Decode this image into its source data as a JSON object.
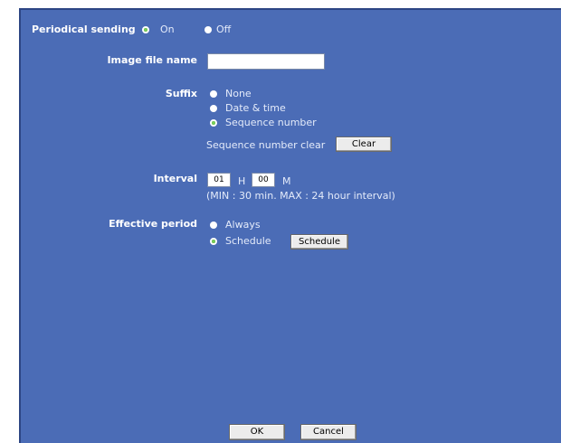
{
  "periodical_sending": {
    "label": "Periodical sending",
    "on_label": "On",
    "off_label": "Off",
    "selected": "On"
  },
  "image_file_name": {
    "label": "Image file name",
    "value": ""
  },
  "suffix": {
    "label": "Suffix",
    "options": [
      "None",
      "Date & time",
      "Sequence number"
    ],
    "selected": "Sequence number",
    "sequence_clear_label": "Sequence number clear",
    "clear_button": "Clear"
  },
  "interval": {
    "label": "Interval",
    "hours": "01",
    "hours_unit": "H",
    "minutes": "00",
    "minutes_unit": "M",
    "note": "(MIN : 30 min. MAX : 24 hour interval)"
  },
  "effective_period": {
    "label": "Effective period",
    "options": [
      "Always",
      "Schedule"
    ],
    "selected": "Schedule",
    "schedule_button": "Schedule"
  },
  "footer": {
    "ok": "OK",
    "cancel": "Cancel"
  },
  "colors": {
    "panel_bg": "#4b6cb6",
    "selected_radio": "#7ad157"
  }
}
